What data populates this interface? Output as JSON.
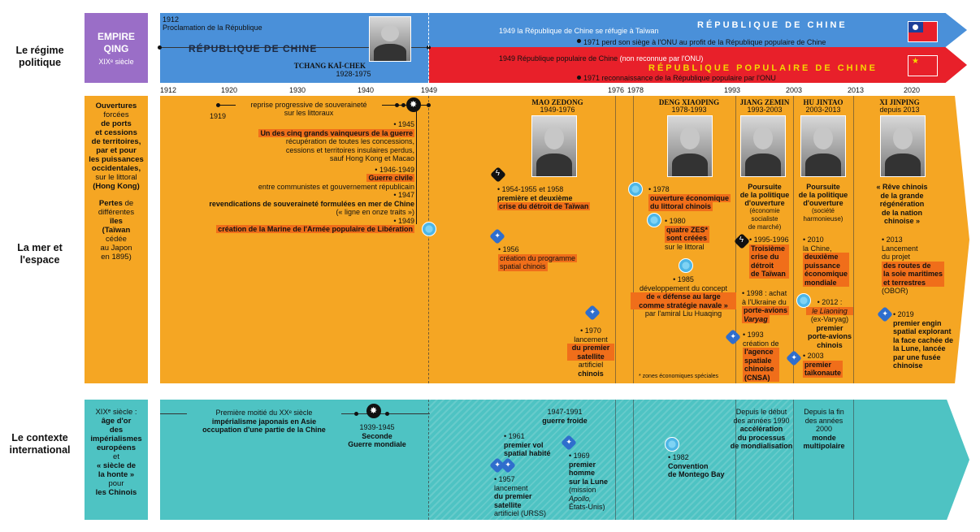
{
  "rows": {
    "regime": "Le régime politique",
    "sea": "La mer et l'espace",
    "context": "Le contexte international"
  },
  "qing": {
    "title": "EMPIRE QING",
    "sub": "XIXᵉ siècle"
  },
  "roc_left": {
    "year": "1912",
    "proc": "Proclamation de la République",
    "title": "RÉPUBLIQUE DE CHINE",
    "leader": "TCHANG KAÏ-CHEK",
    "dates": "1928-1975"
  },
  "roc_right": {
    "title": "RÉPUBLIQUE DE CHINE",
    "e1": "1949 la République de Chine se réfugie à Taïwan",
    "e2": "1971 perd son siège à l'ONU au profit de la République populaire de Chine"
  },
  "prc": {
    "title": "RÉPUBLIQUE POPULAIRE DE CHINE",
    "e1a": "1949 République populaire de Chine",
    "e1b": "(non reconnue par l'ONU)",
    "e2": "1971 reconnaissance de la République populaire par l'ONU"
  },
  "years": [
    "1912",
    "1920",
    "1930",
    "1940",
    "1949",
    "1976",
    "1978",
    "1993",
    "2003",
    "2013",
    "2020"
  ],
  "qing_sea": {
    "l1": "Ouvertures",
    "l2": "forcées",
    "l3": "de ports",
    "l4": "et cessions",
    "l5": "de territoires,",
    "l6": "par et pour",
    "l7": "les puissances",
    "l8": "occidentales,",
    "l9": "sur le littoral",
    "l10": "(Hong Kong)",
    "l11": "Pertes",
    "l12": "de",
    "l13": "différentes",
    "l14": "îles",
    "l15": "(Taïwan",
    "l16": "cédée",
    "l17": "au Japon",
    "l18": "en 1895)"
  },
  "roc_sea": {
    "y1919": "1919",
    "reprise1": "reprise progressive de souveraineté",
    "reprise2": "sur les littoraux",
    "y1945": "• 1945",
    "hl1945": "Un des cinq grands vainqueurs de la guerre",
    "recup1": "récupération de toutes les concessions,",
    "recup2": "cessions et territoires insulaires perdus,",
    "recup3": "sauf Hong Kong et Macao",
    "y1946": "• 1946-1949",
    "hl1946": "Guerre civile",
    "civ": "entre communistes et gouvernement républicain",
    "y1947": "• 1947",
    "rev": "revendications de souveraineté formulées en mer de Chine",
    "rev2": "(« ligne en onze traits »)",
    "y1949": "• 1949",
    "hl1949": "création de la Marine de l'Armée populaire de Libération"
  },
  "mao": {
    "name": "MAO ZEDONG",
    "dates": "1949-1976",
    "e1y": "• 1954-1955 et 1958",
    "e1a": "première et deuxième",
    "e1b": "crise du détroit de Taïwan",
    "e2y": "• 1956",
    "e2a": "création du programme",
    "e2b": "spatial chinois",
    "e3y": "• 1970",
    "e3a": "lancement",
    "e3b": "du premier",
    "e3c": "satellite",
    "e3d": "artificiel",
    "e3e": "chinois"
  },
  "deng": {
    "name": "DENG XIAOPING",
    "dates": "1978-1993",
    "e1y": "• 1978",
    "e1a": "ouverture économique",
    "e1b": "du littoral chinois",
    "e2y": "• 1980",
    "e2a": "quatre ZES*",
    "e2b": "sont créées",
    "e2c": "sur le littoral",
    "e3y": "• 1985",
    "e3a": "développement du concept",
    "e3b": "de « défense au large",
    "e3c": "comme stratégie navale »",
    "e3d": "par l'amiral Liu Huaqing",
    "note": "* zones économiques spéciales"
  },
  "jiang": {
    "name": "JIANG ZEMIN",
    "dates": "1993-2003",
    "p1": "Poursuite",
    "p2": "de la politique",
    "p3": "d'ouverture",
    "p4": "(économie",
    "p5": "socialiste",
    "p6": "de marché)",
    "e1y": "• 1995-1996",
    "e1a": "Troisième",
    "e1b": "crise du",
    "e1c": "détroit",
    "e1d": "de Taïwan",
    "e2y": "• 1998 : achat",
    "e2a": "à l'Ukraine du",
    "e2b": "porte-avions",
    "e2c": "Varyag",
    "e3y": "• 1993",
    "e3a": "création de",
    "e3b": "l'agence",
    "e3c": "spatiale",
    "e3d": "chinoise",
    "e3e": "(CNSA)"
  },
  "hu": {
    "name": "HU JINTAO",
    "dates": "2003-2013",
    "p1": "Poursuite",
    "p2": "de la politique",
    "p3": "d'ouverture",
    "p4": "(société",
    "p5": "harmonieuse)",
    "e1y": "• 2010",
    "e1a": "la Chine,",
    "e1b": "deuxième",
    "e1c": "puissance",
    "e1d": "économique",
    "e1e": "mondiale",
    "e2y": "• 2012 :",
    "e2a": "le Liaoning",
    "e2b": "(ex-Varyag)",
    "e2c": "premier",
    "e2d": "porte-avions",
    "e2e": "chinois",
    "e3y": "• 2003",
    "e3a": "premier",
    "e3b": "taïkonaute"
  },
  "xi": {
    "name": "XI JINPING",
    "dates": "depuis 2013",
    "q1": "« Rêve chinois",
    "q2": "de la grande",
    "q3": "régénération",
    "q4": "de la nation",
    "q5": "chinoise »",
    "e1y": "• 2013",
    "e1a": "Lancement",
    "e1b": "du projet",
    "e1c": "des routes de",
    "e1d": "la soie maritimes",
    "e1e": "et terrestres",
    "e1f": "(OBOR)",
    "e2y": "• 2019",
    "e2a": "premier engin",
    "e2b": "spatial explorant",
    "e2c": "la face cachée de",
    "e2d": "la Lune, lancée",
    "e2e": "par une fusée",
    "e2f": "chinoise"
  },
  "ctx_left": {
    "l1": "XIXᵉ siècle :",
    "l2": "âge d'or",
    "l3": "des",
    "l4": "impérialismes",
    "l5": "européens",
    "l6": "et",
    "l7": "« siècle de",
    "l8": "la honte »",
    "l9": "pour",
    "l10": "les Chinois"
  },
  "ctx": {
    "e1a": "Première moitié du XXᵉ siècle",
    "e1b": "impérialisme japonais en Asie",
    "e1c": "occupation d'une partie de la Chine",
    "e2y": "1939-1945",
    "e2a": "Seconde",
    "e2b": "Guerre mondiale",
    "cw1": "1947-1991",
    "cw2": "guerre froide",
    "s1y": "• 1961",
    "s1a": "premier vol",
    "s1b": "spatial habité",
    "s2y": "• 1969",
    "s2a": "premier",
    "s2b": "homme",
    "s2c": "sur la Lune",
    "s2d": "(mission",
    "s2e": "Apollo,",
    "s2f": "États-Unis)",
    "s3y": "• 1957",
    "s3a": "lancement",
    "s3b": "du premier",
    "s3c": "satellite",
    "s3d": "artificiel (URSS)",
    "m1y": "• 1982",
    "m1a": "Convention",
    "m1b": "de Montego Bay",
    "g1": "Depuis le début",
    "g2": "des années 1990",
    "g3": "accélération",
    "g4": "du processus",
    "g5": "de mondialisation",
    "g6": "Depuis la fin",
    "g7": "des années",
    "g8": "2000",
    "g9": "monde",
    "g10": "multipolaire"
  },
  "colors": {
    "purple": "#9a6ec7",
    "blue": "#4a90d9",
    "red": "#e8202a",
    "orange": "#f5a623",
    "teal": "#4ec3c3",
    "hl": "#f06e1a"
  }
}
